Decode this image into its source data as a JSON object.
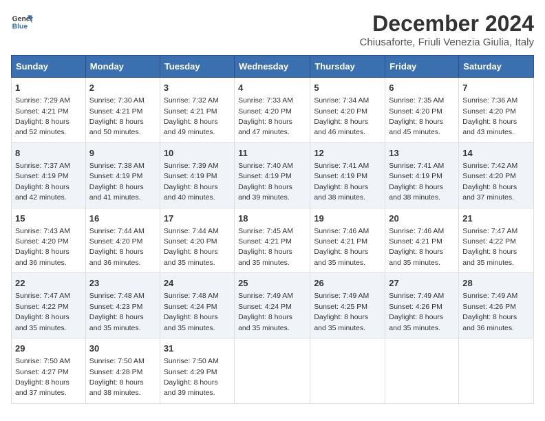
{
  "header": {
    "logo_line1": "General",
    "logo_line2": "Blue",
    "month_title": "December 2024",
    "location": "Chiusaforte, Friuli Venezia Giulia, Italy"
  },
  "days_of_week": [
    "Sunday",
    "Monday",
    "Tuesday",
    "Wednesday",
    "Thursday",
    "Friday",
    "Saturday"
  ],
  "weeks": [
    [
      {
        "day": 1,
        "info": "Sunrise: 7:29 AM\nSunset: 4:21 PM\nDaylight: 8 hours\nand 52 minutes."
      },
      {
        "day": 2,
        "info": "Sunrise: 7:30 AM\nSunset: 4:21 PM\nDaylight: 8 hours\nand 50 minutes."
      },
      {
        "day": 3,
        "info": "Sunrise: 7:32 AM\nSunset: 4:21 PM\nDaylight: 8 hours\nand 49 minutes."
      },
      {
        "day": 4,
        "info": "Sunrise: 7:33 AM\nSunset: 4:20 PM\nDaylight: 8 hours\nand 47 minutes."
      },
      {
        "day": 5,
        "info": "Sunrise: 7:34 AM\nSunset: 4:20 PM\nDaylight: 8 hours\nand 46 minutes."
      },
      {
        "day": 6,
        "info": "Sunrise: 7:35 AM\nSunset: 4:20 PM\nDaylight: 8 hours\nand 45 minutes."
      },
      {
        "day": 7,
        "info": "Sunrise: 7:36 AM\nSunset: 4:20 PM\nDaylight: 8 hours\nand 43 minutes."
      }
    ],
    [
      {
        "day": 8,
        "info": "Sunrise: 7:37 AM\nSunset: 4:19 PM\nDaylight: 8 hours\nand 42 minutes."
      },
      {
        "day": 9,
        "info": "Sunrise: 7:38 AM\nSunset: 4:19 PM\nDaylight: 8 hours\nand 41 minutes."
      },
      {
        "day": 10,
        "info": "Sunrise: 7:39 AM\nSunset: 4:19 PM\nDaylight: 8 hours\nand 40 minutes."
      },
      {
        "day": 11,
        "info": "Sunrise: 7:40 AM\nSunset: 4:19 PM\nDaylight: 8 hours\nand 39 minutes."
      },
      {
        "day": 12,
        "info": "Sunrise: 7:41 AM\nSunset: 4:19 PM\nDaylight: 8 hours\nand 38 minutes."
      },
      {
        "day": 13,
        "info": "Sunrise: 7:41 AM\nSunset: 4:19 PM\nDaylight: 8 hours\nand 38 minutes."
      },
      {
        "day": 14,
        "info": "Sunrise: 7:42 AM\nSunset: 4:20 PM\nDaylight: 8 hours\nand 37 minutes."
      }
    ],
    [
      {
        "day": 15,
        "info": "Sunrise: 7:43 AM\nSunset: 4:20 PM\nDaylight: 8 hours\nand 36 minutes."
      },
      {
        "day": 16,
        "info": "Sunrise: 7:44 AM\nSunset: 4:20 PM\nDaylight: 8 hours\nand 36 minutes."
      },
      {
        "day": 17,
        "info": "Sunrise: 7:44 AM\nSunset: 4:20 PM\nDaylight: 8 hours\nand 35 minutes."
      },
      {
        "day": 18,
        "info": "Sunrise: 7:45 AM\nSunset: 4:21 PM\nDaylight: 8 hours\nand 35 minutes."
      },
      {
        "day": 19,
        "info": "Sunrise: 7:46 AM\nSunset: 4:21 PM\nDaylight: 8 hours\nand 35 minutes."
      },
      {
        "day": 20,
        "info": "Sunrise: 7:46 AM\nSunset: 4:21 PM\nDaylight: 8 hours\nand 35 minutes."
      },
      {
        "day": 21,
        "info": "Sunrise: 7:47 AM\nSunset: 4:22 PM\nDaylight: 8 hours\nand 35 minutes."
      }
    ],
    [
      {
        "day": 22,
        "info": "Sunrise: 7:47 AM\nSunset: 4:22 PM\nDaylight: 8 hours\nand 35 minutes."
      },
      {
        "day": 23,
        "info": "Sunrise: 7:48 AM\nSunset: 4:23 PM\nDaylight: 8 hours\nand 35 minutes."
      },
      {
        "day": 24,
        "info": "Sunrise: 7:48 AM\nSunset: 4:24 PM\nDaylight: 8 hours\nand 35 minutes."
      },
      {
        "day": 25,
        "info": "Sunrise: 7:49 AM\nSunset: 4:24 PM\nDaylight: 8 hours\nand 35 minutes."
      },
      {
        "day": 26,
        "info": "Sunrise: 7:49 AM\nSunset: 4:25 PM\nDaylight: 8 hours\nand 35 minutes."
      },
      {
        "day": 27,
        "info": "Sunrise: 7:49 AM\nSunset: 4:26 PM\nDaylight: 8 hours\nand 35 minutes."
      },
      {
        "day": 28,
        "info": "Sunrise: 7:49 AM\nSunset: 4:26 PM\nDaylight: 8 hours\nand 36 minutes."
      }
    ],
    [
      {
        "day": 29,
        "info": "Sunrise: 7:50 AM\nSunset: 4:27 PM\nDaylight: 8 hours\nand 37 minutes."
      },
      {
        "day": 30,
        "info": "Sunrise: 7:50 AM\nSunset: 4:28 PM\nDaylight: 8 hours\nand 38 minutes."
      },
      {
        "day": 31,
        "info": "Sunrise: 7:50 AM\nSunset: 4:29 PM\nDaylight: 8 hours\nand 39 minutes."
      },
      null,
      null,
      null,
      null
    ]
  ]
}
